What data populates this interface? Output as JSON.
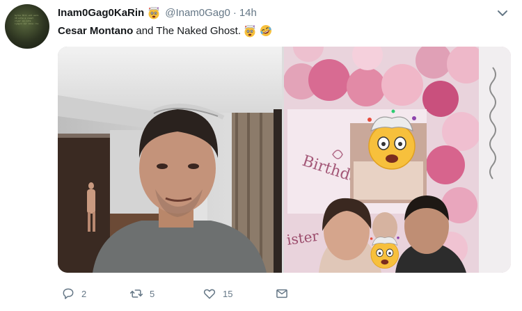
{
  "tweet": {
    "display_name": "Inam0Gag0KaRin",
    "handle": "@Inam0Gag0",
    "separator": "·",
    "time": "14h",
    "text_bold": "Cesar Montano",
    "text_rest": "and The Naked Ghost.",
    "avatar_text": "Gyrus Hill wid wars 10 wile e coast ciyar so cuts iyagin nur mine ris"
  },
  "icons": {
    "name_emoji": "exploding-head-emoji",
    "text_emoji_1": "exploding-head-emoji",
    "text_emoji_2": "rolling-on-floor-laughing-emoji",
    "menu": "chevron-down-icon"
  },
  "actions": {
    "reply_count": "2",
    "retweet_count": "5",
    "like_count": "15"
  },
  "colors": {
    "text": "#14171a",
    "secondary": "#657786",
    "emoji_yellow": "#f7c03c"
  }
}
